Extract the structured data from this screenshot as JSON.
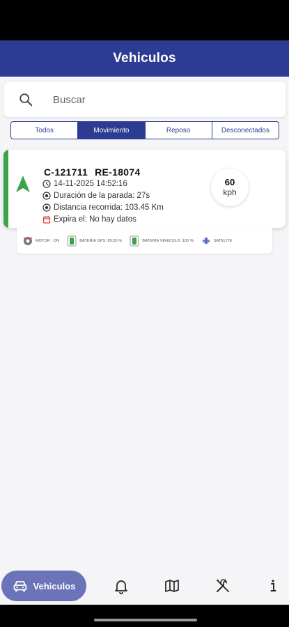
{
  "app": {
    "title": "Vehiculos"
  },
  "search": {
    "placeholder": "Buscar"
  },
  "tabs": [
    {
      "label": "Todos"
    },
    {
      "label": "Movimiento"
    },
    {
      "label": "Reposo"
    },
    {
      "label": "Desconectados"
    }
  ],
  "vehicle": {
    "plate_1": "C-121711",
    "plate_2": "RE-18074",
    "datetime": "14-11-2025 14:52:16",
    "stop_duration": "Duración de la parada: 27s",
    "distance": "Distancia recorrida: 103.45 Km",
    "expires": "Expira el: No hay datos",
    "speed_value": "60",
    "speed_unit": "kph",
    "status_color": "#3aa548",
    "direction_icon": "navigation-arrow-icon"
  },
  "sensors": [
    {
      "icon": "engine-icon",
      "label": "MOTOR : ON"
    },
    {
      "icon": "battery-icon",
      "label": "BATERIA GPS: 85.50 %"
    },
    {
      "icon": "battery-icon",
      "label": "BATERIA VEHICULO: 100 %"
    },
    {
      "icon": "satellite-icon",
      "label": "SATELITE"
    }
  ],
  "nav": {
    "active_label": "Vehiculos",
    "items": [
      "car-icon",
      "bell-icon",
      "map-icon",
      "tools-icon",
      "info-icon"
    ]
  },
  "colors": {
    "primary": "#2c3c92",
    "nav_active": "#6b74b8",
    "moving": "#3aa548"
  }
}
